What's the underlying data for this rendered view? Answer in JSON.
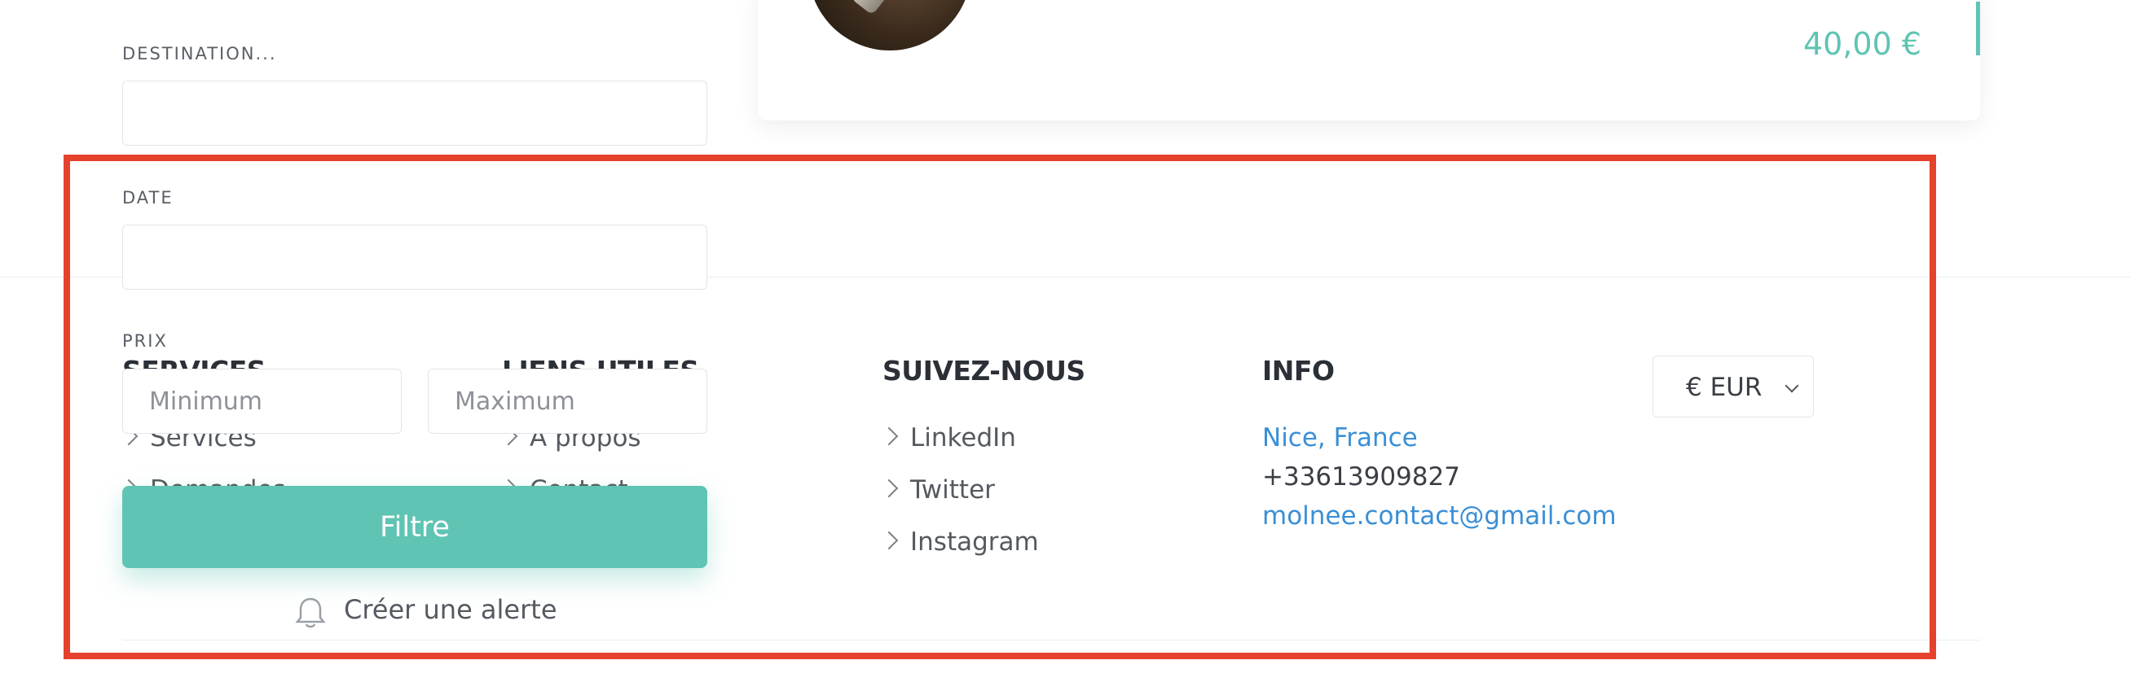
{
  "card": {
    "price": "40,00 €"
  },
  "filters": {
    "destination_label": "DESTINATION...",
    "date_label": "DATE",
    "price_label": "PRIX",
    "min_placeholder": "Minimum",
    "max_placeholder": "Maximum",
    "filter_button": "Filtre",
    "alert_label": "Créer une alerte"
  },
  "footer": {
    "services": {
      "title": "SERVICES",
      "items": [
        "Services",
        "Demandes"
      ]
    },
    "liens": {
      "title": "LIENS UTILES",
      "items": [
        "À propos",
        "Contact"
      ]
    },
    "suivez": {
      "title": "SUIVEZ-NOUS",
      "items": [
        "LinkedIn",
        "Twitter",
        "Instagram"
      ]
    },
    "info": {
      "title": "INFO",
      "location": "Nice, France",
      "phone": "+33613909827",
      "email": "molnee.contact@gmail.com"
    },
    "currency": "€ EUR"
  },
  "colors": {
    "accent": "#5fc4b3",
    "link": "#3a8fd6",
    "highlight": "#e5412d"
  },
  "icons": [
    "chevron-right-icon",
    "bell-icon",
    "chevron-down-icon"
  ]
}
